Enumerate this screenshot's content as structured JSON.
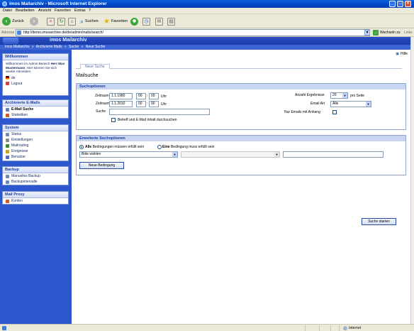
{
  "window": {
    "title": "imos Mailarchiv - Microsoft Internet Explorer"
  },
  "menu": [
    "Datei",
    "Bearbeiten",
    "Ansicht",
    "Favoriten",
    "Extras",
    "?"
  ],
  "toolbar": {
    "back": "Zurück",
    "search": "Suchen",
    "favorites": "Favoriten"
  },
  "address": {
    "label": "Adresse",
    "url": "http://demo.imosarchive.de/de/admin/mails/search/",
    "go": "Wechseln zu",
    "links": "Links"
  },
  "app": {
    "title": "imos Mailarchiv"
  },
  "breadcrumb": [
    "imos Mailarchiv",
    "»",
    "Archivierte Mails",
    "»",
    "Suche",
    "»",
    "Neue Suche"
  ],
  "sidebar": {
    "welcome": {
      "title": "Willkommen",
      "text_before": "Willkommen im Admin-Bereich ",
      "user": "Herr Max Mustermann",
      "text_after": ". Hier können Sie sich wieder Abmelden.",
      "lang": "de",
      "logout": "Logout"
    },
    "archived": {
      "title": "Archivierte E-Mails",
      "items": [
        "E-Mail Suche",
        "Statistiken"
      ]
    },
    "system": {
      "title": "System",
      "items": [
        "Status",
        "Einstellungen",
        "Mailrouting",
        "Ereignisse",
        "Benutzer"
      ]
    },
    "backup": {
      "title": "Backup",
      "items": [
        "Manuelles Backup",
        "Backupintervalle"
      ]
    },
    "proxy": {
      "title": "Mail Proxy",
      "items": [
        "Konten"
      ]
    }
  },
  "main": {
    "help": "Hilfe",
    "tab": "Neue Suche",
    "heading": "Mailsuche",
    "options": {
      "title": "Suchoptionen",
      "from_label": "Zeitraum (Von)",
      "from_date": "1.1.1980",
      "from_h": "00",
      "from_m": "00",
      "to_label": "Zeitraum (Bis)",
      "to_date": "1.1.2010",
      "to_h": "00",
      "to_m": "00",
      "colon": ":",
      "uhr": "Uhr",
      "search_label": "Suche",
      "search_value": "",
      "subject_cb": "Betreff und E-Mail Inhalt durchsuchen",
      "results_label": "Anzahl Ergebnisse",
      "results_value": "20",
      "per_page": "pro Seite",
      "mailtype_label": "Email Art",
      "mailtype_value": "Alle",
      "attach_label": "Nur Emails mit Anhang"
    },
    "advanced": {
      "title": "Erweiterte Suchoptionen",
      "all_bold": "Alle",
      "all_rest": "Bedingungen müssen erfüllt sein",
      "one_bold": "Eine",
      "one_rest": "Bedingung muss erfüllt sein",
      "field_select": "Bitte wählen",
      "op_select": "",
      "value": "",
      "add_btn": "Neue Bedingung"
    },
    "submit": "Suche starten"
  },
  "status": {
    "text": "",
    "zone": "Internet"
  }
}
